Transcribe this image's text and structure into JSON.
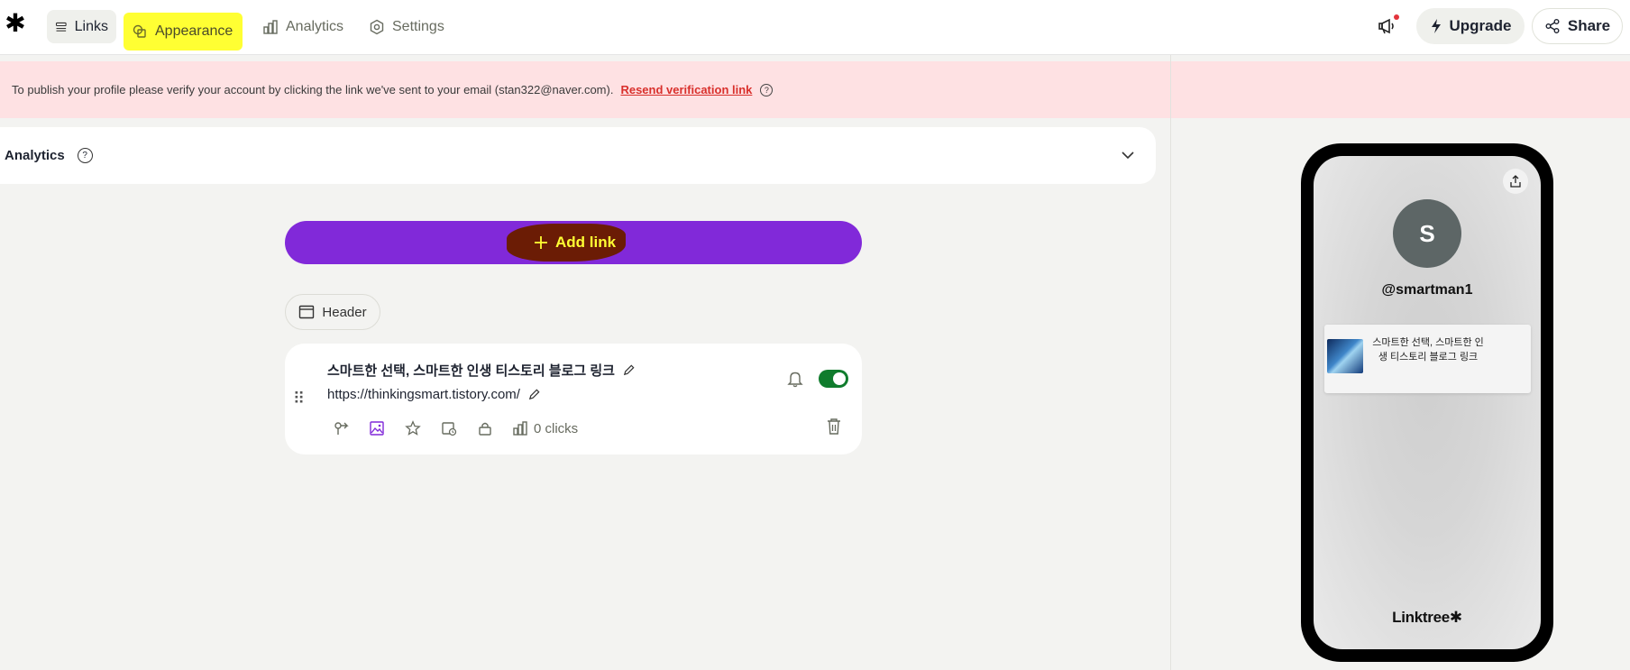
{
  "app": {
    "logo_glyph": "✱"
  },
  "nav": {
    "links": "Links",
    "appearance": "Appearance",
    "analytics": "Analytics",
    "settings": "Settings"
  },
  "header_actions": {
    "upgrade": "Upgrade",
    "share": "Share"
  },
  "banner": {
    "message": "To publish your profile please verify your account by clicking the link we've sent to your email (stan322@naver.com).",
    "resend": "Resend verification link",
    "help": "?"
  },
  "analytics_panel": {
    "title": "Analytics",
    "help": "?"
  },
  "add_link": {
    "label": "Add link"
  },
  "header_chip": {
    "label": "Header"
  },
  "link_card": {
    "title": "스마트한 선택, 스마트한 인생 티스토리 블로그 링크",
    "url": "https://thinkingsmart.tistory.com/",
    "clicks": "0 clicks",
    "enabled": true
  },
  "preview": {
    "avatar_letter": "S",
    "handle": "@smartman1",
    "link_text": "스마트한 선택, 스마트한 인생 티스토리 블로그 링크",
    "brand": "Linktree✱"
  },
  "colors": {
    "accent_purple": "#8129d9",
    "toggle_green": "#107c2d",
    "banner_pink": "#fee1e3",
    "highlight_yellow": "#ffff33",
    "link_red": "#d9302c"
  }
}
